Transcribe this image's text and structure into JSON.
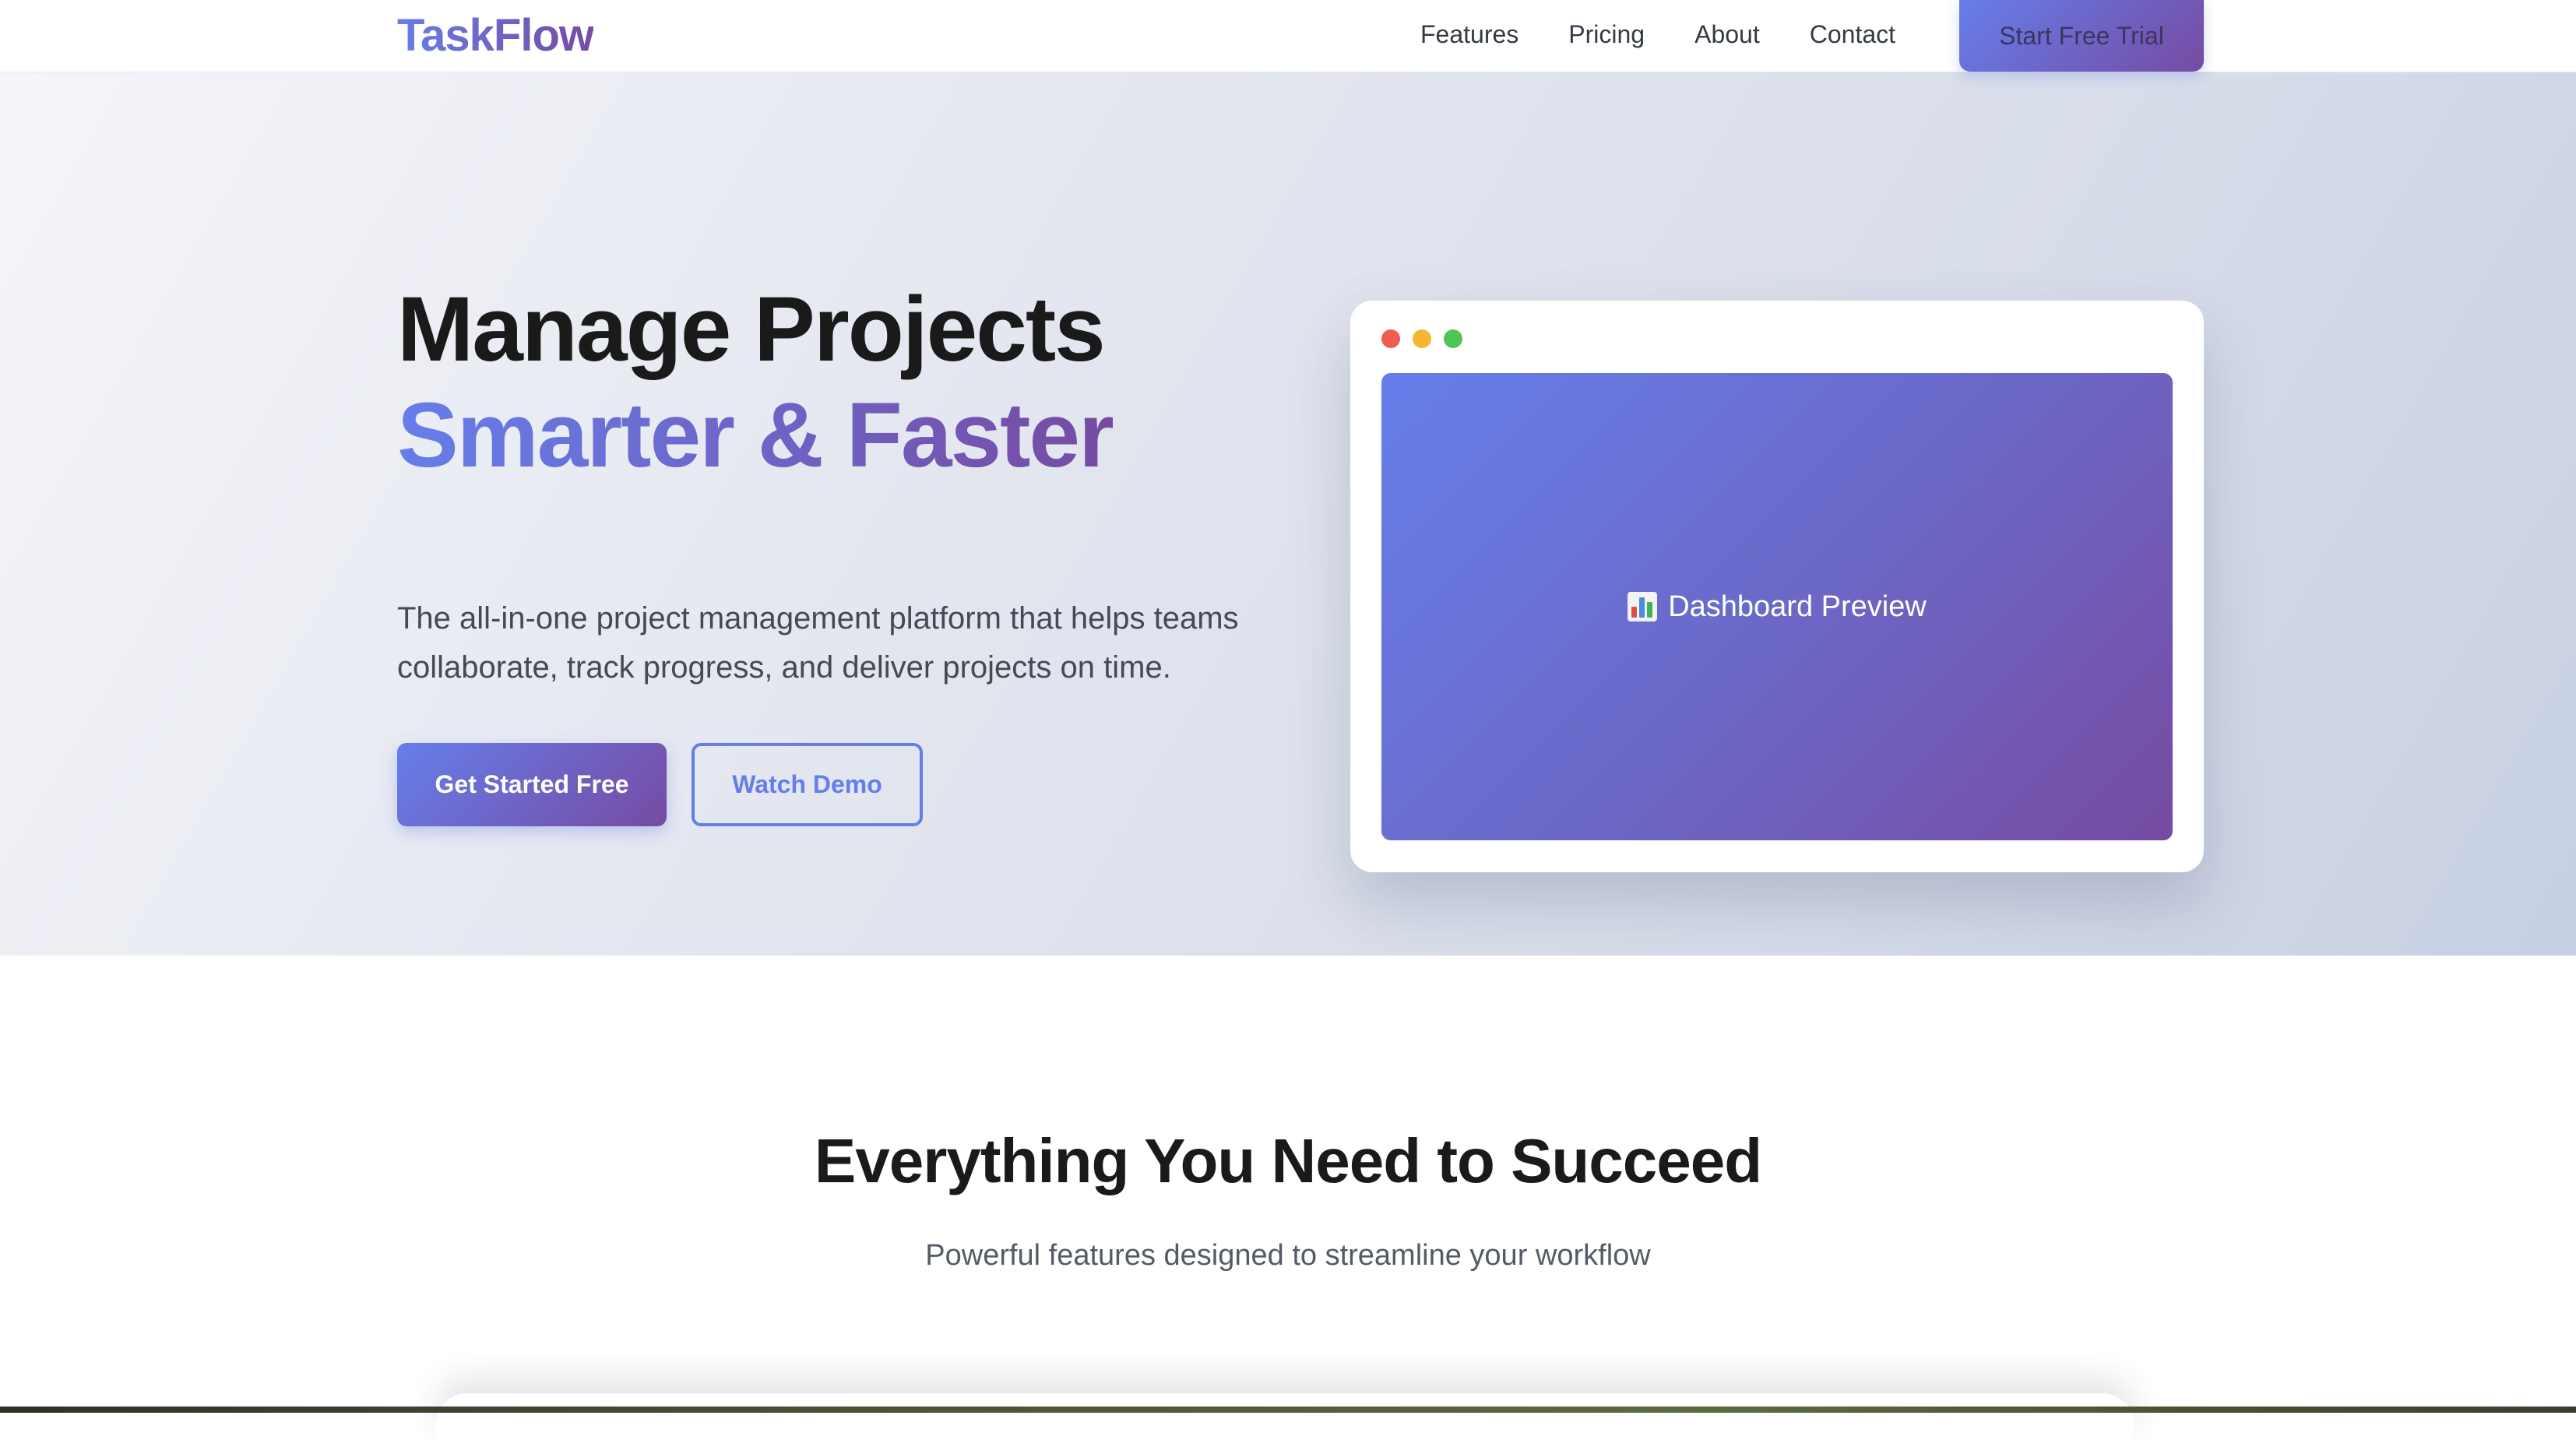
{
  "nav": {
    "logo": "TaskFlow",
    "links": [
      "Features",
      "Pricing",
      "About",
      "Contact"
    ],
    "cta": "Start Free Trial"
  },
  "hero": {
    "title_line1": "Manage Projects",
    "title_line2": "Smarter & Faster",
    "subtitle": "The all-in-one project management platform that helps teams collaborate, track progress, and deliver projects on time.",
    "primary_button": "Get Started Free",
    "secondary_button": "Watch Demo",
    "preview_label": "Dashboard Preview",
    "preview_icon": "bar-chart-icon"
  },
  "features": {
    "title": "Everything You Need to Succeed",
    "subtitle": "Powerful features designed to streamline your workflow"
  },
  "colors": {
    "accent_start": "#667eea",
    "accent_end": "#764ba2",
    "dot_red": "#ee5c52",
    "dot_yellow": "#f5b731",
    "dot_green": "#4fc556"
  }
}
